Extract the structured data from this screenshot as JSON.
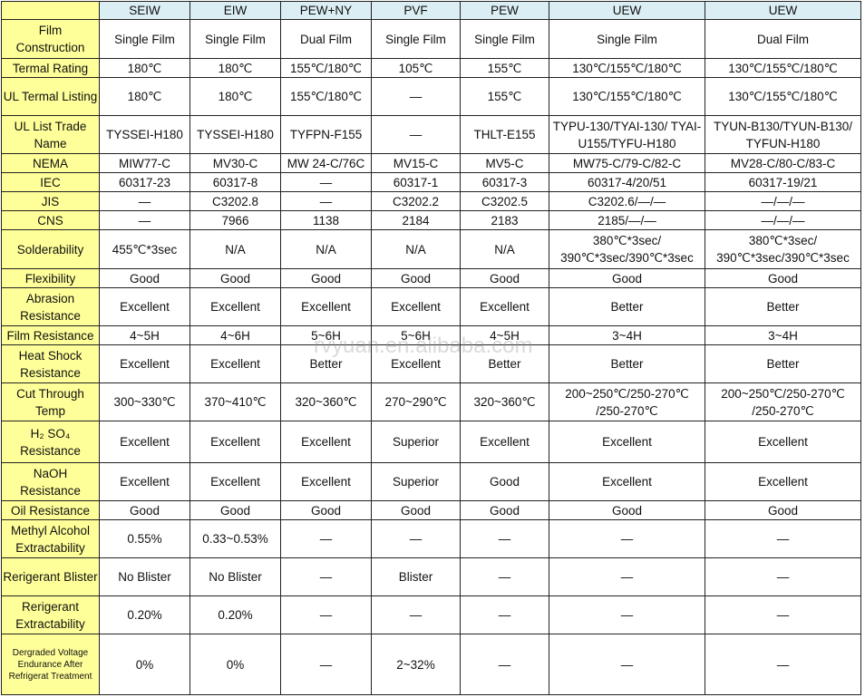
{
  "columns": [
    "",
    "SEIW",
    "EIW",
    "PEW+NY",
    "PVF",
    "PEW",
    "UEW",
    "UEW"
  ],
  "rows": [
    {
      "label": "Film Construction",
      "cells": [
        "Single Film",
        "Single Film",
        "Dual Film",
        "Single Film",
        "Single Film",
        "Single Film",
        "Dual Film"
      ]
    },
    {
      "label": "Termal Rating",
      "cells": [
        "180℃",
        "180℃",
        "155℃/180℃",
        "105℃",
        "155℃",
        "130℃/155℃/180℃",
        "130℃/155℃/180℃"
      ]
    },
    {
      "label": "UL Termal Listing",
      "cells": [
        "180℃",
        "180℃",
        "155℃/180℃",
        "—",
        "155℃",
        "130℃/155℃/180℃",
        "130℃/155℃/180℃"
      ]
    },
    {
      "label": "UL List Trade Name",
      "cells": [
        "TYSSEI-H180",
        "TYSSEI-H180",
        "TYFPN-F155",
        "—",
        "THLT-E155",
        "TYPU-130/TYAI-130/ TYAI-U155/TYFU-H180",
        "TYUN-B130/TYUN-B130/ TYFUN-H180"
      ]
    },
    {
      "label": "NEMA",
      "cells": [
        "MIW77-C",
        "MV30-C",
        "MW 24-C/76C",
        "MV15-C",
        "MV5-C",
        "MW75-C/79-C/82-C",
        "MV28-C/80-C/83-C"
      ]
    },
    {
      "label": "IEC",
      "cells": [
        "60317-23",
        "60317-8",
        "—",
        "60317-1",
        "60317-3",
        "60317-4/20/51",
        "60317-19/21"
      ]
    },
    {
      "label": "JIS",
      "cells": [
        "—",
        "C3202.8",
        "—",
        "C3202.2",
        "C3202.5",
        "C3202.6/—/—",
        "—/—/—"
      ]
    },
    {
      "label": "CNS",
      "cells": [
        "—",
        "7966",
        "1138",
        "2184",
        "2183",
        "2185/—/—",
        "—/—/—"
      ]
    },
    {
      "label": "Solderability",
      "cells": [
        "455℃*3sec",
        "N/A",
        "N/A",
        "N/A",
        "N/A",
        "380℃*3sec/ 390℃*3sec/390℃*3sec",
        "380℃*3sec/ 390℃*3sec/390℃*3sec"
      ]
    },
    {
      "label": "Flexibility",
      "cells": [
        "Good",
        "Good",
        "Good",
        "Good",
        "Good",
        "Good",
        "Good"
      ]
    },
    {
      "label": "Abrasion Resistance",
      "cells": [
        "Excellent",
        "Excellent",
        "Excellent",
        "Excellent",
        "Excellent",
        "Better",
        "Better"
      ]
    },
    {
      "label": "Film Resistance",
      "cells": [
        "4~5H",
        "4~6H",
        "5~6H",
        "5~6H",
        "4~5H",
        "3~4H",
        "3~4H"
      ]
    },
    {
      "label": "Heat Shock Resistance",
      "cells": [
        "Excellent",
        "Excellent",
        "Better",
        "Excellent",
        "Better",
        "Better",
        "Better"
      ]
    },
    {
      "label": "Cut Through Temp",
      "cells": [
        "300~330℃",
        "370~410℃",
        "320~360℃",
        "270~290℃",
        "320~360℃",
        "200~250℃/250-270℃ /250-270℃",
        "200~250℃/250-270℃ /250-270℃"
      ]
    },
    {
      "label": "H₂ SO₄ Resistance",
      "cells": [
        "Excellent",
        "Excellent",
        "Excellent",
        "Superior",
        "Excellent",
        "Excellent",
        "Excellent"
      ]
    },
    {
      "label": "NaOH Resistance",
      "cells": [
        "Excellent",
        "Excellent",
        "Excellent",
        "Superior",
        "Good",
        "Excellent",
        "Excellent"
      ]
    },
    {
      "label": "Oil Resistance",
      "cells": [
        "Good",
        "Good",
        "Good",
        "Good",
        "Good",
        "Good",
        "Good"
      ]
    },
    {
      "label": "Methyl Alcohol Extractability",
      "cells": [
        "0.55%",
        "0.33~0.53%",
        "—",
        "—",
        "—",
        "—",
        "—"
      ]
    },
    {
      "label": "Rerigerant Blister",
      "cells": [
        "No Blister",
        "No Blister",
        "—",
        "Blister",
        "—",
        "—",
        "—"
      ]
    },
    {
      "label": "Rerigerant Extractability",
      "cells": [
        "0.20%",
        "0.20%",
        "—",
        "—",
        "—",
        "—",
        "—"
      ]
    },
    {
      "label": "Dergraded Voltage Endurance After Refrigerat Treatment",
      "cells": [
        "0%",
        "0%",
        "—",
        "2~32%",
        "—",
        "—",
        "—"
      ]
    }
  ],
  "watermark": "rvyuan.en.alibaba.com",
  "colors": {
    "header_bg": "#dbeef3",
    "label_bg": "#ffff99",
    "border": "#222222"
  }
}
